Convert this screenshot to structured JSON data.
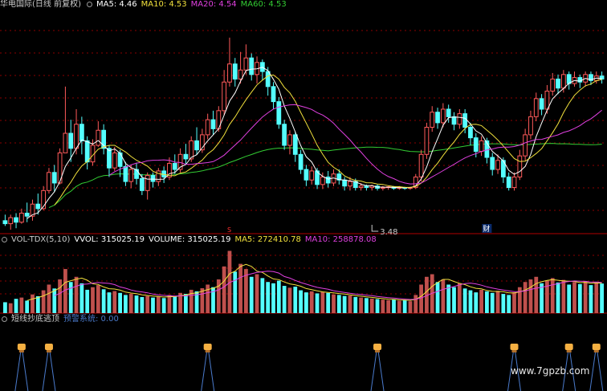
{
  "header": {
    "stock_title": "华电国际(日线 前复权)",
    "indicators": [
      {
        "label": "MA5: 4.46",
        "color": "#ffffff"
      },
      {
        "label": "MA10: 4.53",
        "color": "#f2e13c"
      },
      {
        "label": "MA20: 4.54",
        "color": "#e040e0"
      },
      {
        "label": "MA60: 4.53",
        "color": "#33cc33"
      }
    ]
  },
  "volume_header": {
    "name": "VOL-TDX(5,10)",
    "vvol": "VVOL: 315025.19",
    "volume": "VOLUME: 315025.19",
    "ma5": "MA5: 272410.78",
    "ma10": "MA10: 258878.08"
  },
  "indicator_header": {
    "name": "短线抄底逃顶",
    "system": "预警系统: 0.00"
  },
  "markers": {
    "low_price": "3.48",
    "cai_badge": "财",
    "s_badge": "S"
  },
  "watermark": "www.7gpzb.com",
  "colors": {
    "up": "#ff5a5a",
    "down": "#54ffff",
    "ma5": "#ffffff",
    "ma10": "#f2e13c",
    "ma20": "#e040e0",
    "ma60": "#33cc33",
    "volume_up": "#c0504d",
    "grid": "#8b0000",
    "signal": "#4a7acb",
    "badge": "#f5b042"
  },
  "chart_data": {
    "type": "candlestick",
    "y_min": 3.48,
    "y_max": 6.4,
    "ma_windows": [
      5,
      10,
      20,
      60
    ],
    "candles": [
      [
        3.62,
        3.58,
        3.7,
        3.55
      ],
      [
        3.58,
        3.66,
        3.7,
        3.5
      ],
      [
        3.66,
        3.6,
        3.72,
        3.52
      ],
      [
        3.6,
        3.72,
        3.78,
        3.58
      ],
      [
        3.72,
        3.68,
        3.86,
        3.6
      ],
      [
        3.68,
        3.84,
        3.9,
        3.62
      ],
      [
        3.84,
        3.78,
        3.98,
        3.7
      ],
      [
        3.78,
        4.02,
        4.08,
        3.76
      ],
      [
        4.02,
        4.26,
        4.32,
        3.98
      ],
      [
        4.26,
        4.12,
        4.36,
        4.0
      ],
      [
        4.12,
        4.52,
        4.58,
        4.1
      ],
      [
        4.52,
        4.78,
        5.4,
        4.6
      ],
      [
        4.78,
        4.58,
        4.96,
        4.4
      ],
      [
        4.58,
        4.9,
        5.1,
        4.5
      ],
      [
        4.9,
        4.68,
        5.0,
        4.5
      ],
      [
        4.68,
        4.4,
        4.74,
        4.3
      ],
      [
        4.4,
        4.62,
        4.7,
        4.35
      ],
      [
        4.62,
        4.82,
        4.94,
        4.6
      ],
      [
        4.82,
        4.58,
        4.9,
        4.5
      ],
      [
        4.58,
        4.32,
        4.62,
        4.2
      ],
      [
        4.32,
        4.52,
        4.6,
        4.28
      ],
      [
        4.52,
        4.34,
        4.56,
        4.2
      ],
      [
        4.34,
        4.14,
        4.4,
        4.08
      ],
      [
        4.14,
        4.3,
        4.36,
        4.05
      ],
      [
        4.3,
        4.18,
        4.38,
        4.1
      ],
      [
        4.18,
        4.02,
        4.24,
        3.96
      ],
      [
        4.02,
        4.22,
        4.26,
        3.9
      ],
      [
        4.22,
        4.14,
        4.26,
        4.06
      ],
      [
        4.14,
        4.28,
        4.32,
        4.08
      ],
      [
        4.28,
        4.2,
        4.34,
        4.12
      ],
      [
        4.2,
        4.38,
        4.46,
        4.16
      ],
      [
        4.38,
        4.3,
        4.5,
        4.24
      ],
      [
        4.3,
        4.5,
        4.58,
        4.26
      ],
      [
        4.5,
        4.44,
        4.64,
        4.36
      ],
      [
        4.44,
        4.68,
        4.74,
        4.4
      ],
      [
        4.68,
        4.56,
        4.86,
        4.5
      ],
      [
        4.56,
        4.76,
        4.84,
        4.52
      ],
      [
        4.76,
        4.96,
        5.04,
        4.7
      ],
      [
        4.96,
        4.84,
        5.08,
        4.76
      ],
      [
        4.84,
        5.08,
        5.14,
        4.8
      ],
      [
        5.08,
        5.46,
        5.62,
        5.02
      ],
      [
        5.46,
        5.7,
        6.05,
        5.4
      ],
      [
        5.7,
        5.5,
        5.78,
        5.4
      ],
      [
        5.5,
        5.62,
        5.86,
        5.44
      ],
      [
        5.62,
        5.78,
        5.96,
        5.56
      ],
      [
        5.78,
        5.56,
        5.84,
        5.48
      ],
      [
        5.56,
        5.72,
        5.8,
        5.44
      ],
      [
        5.72,
        5.6,
        5.76,
        5.48
      ],
      [
        5.6,
        5.4,
        5.66,
        5.28
      ],
      [
        5.4,
        5.2,
        5.46,
        5.1
      ],
      [
        5.2,
        4.9,
        5.26,
        4.84
      ],
      [
        4.9,
        4.62,
        4.96,
        4.56
      ],
      [
        4.62,
        4.76,
        4.82,
        4.5
      ],
      [
        4.76,
        4.5,
        4.8,
        4.4
      ],
      [
        4.5,
        4.3,
        4.56,
        4.24
      ],
      [
        4.3,
        4.16,
        4.36,
        4.08
      ],
      [
        4.16,
        4.28,
        4.34,
        4.1
      ],
      [
        4.28,
        4.1,
        4.32,
        4.04
      ],
      [
        4.1,
        4.2,
        4.26,
        4.04
      ],
      [
        4.2,
        4.12,
        4.28,
        4.06
      ],
      [
        4.12,
        4.24,
        4.3,
        4.08
      ],
      [
        4.24,
        4.16,
        4.3,
        4.1
      ],
      [
        4.16,
        4.08,
        4.2,
        4.02
      ],
      [
        4.08,
        4.14,
        4.2,
        4.02
      ],
      [
        4.14,
        4.06,
        4.18,
        4.02
      ],
      [
        4.06,
        4.08,
        4.12,
        4.02
      ],
      [
        4.08,
        4.06,
        4.1,
        4.02
      ],
      [
        4.06,
        4.08,
        4.1,
        4.02
      ],
      [
        4.08,
        4.05,
        4.1,
        4.02
      ],
      [
        4.05,
        4.06,
        4.08,
        4.02
      ],
      [
        4.06,
        4.07,
        4.08,
        4.03
      ],
      [
        4.07,
        4.05,
        4.08,
        4.03
      ],
      [
        4.05,
        4.06,
        4.08,
        4.03
      ],
      [
        4.06,
        4.05,
        4.07,
        4.03
      ],
      [
        4.05,
        4.06,
        4.07,
        4.03
      ],
      [
        4.06,
        4.2,
        4.24,
        4.04
      ],
      [
        4.2,
        4.5,
        4.56,
        4.14
      ],
      [
        4.5,
        4.86,
        4.92,
        4.44
      ],
      [
        4.86,
        5.06,
        5.14,
        4.8
      ],
      [
        5.06,
        4.92,
        5.12,
        4.84
      ],
      [
        4.92,
        5.1,
        5.18,
        4.86
      ],
      [
        5.1,
        5.0,
        5.16,
        4.92
      ],
      [
        5.0,
        4.9,
        5.06,
        4.82
      ],
      [
        4.9,
        5.04,
        5.1,
        4.84
      ],
      [
        5.04,
        4.86,
        5.1,
        4.78
      ],
      [
        4.86,
        4.72,
        4.92,
        4.62
      ],
      [
        4.72,
        4.54,
        4.78,
        4.46
      ],
      [
        4.54,
        4.68,
        4.74,
        4.48
      ],
      [
        4.68,
        4.46,
        4.72,
        4.38
      ],
      [
        4.46,
        4.3,
        4.52,
        4.22
      ],
      [
        4.3,
        4.42,
        4.5,
        4.24
      ],
      [
        4.42,
        4.2,
        4.46,
        4.12
      ],
      [
        4.2,
        4.06,
        4.26,
        4.02
      ],
      [
        4.06,
        4.2,
        4.26,
        4.02
      ],
      [
        4.2,
        4.48,
        4.56,
        4.16
      ],
      [
        4.48,
        4.76,
        4.84,
        4.42
      ],
      [
        4.76,
        5.0,
        5.08,
        4.7
      ],
      [
        5.0,
        5.24,
        5.32,
        4.94
      ],
      [
        5.24,
        5.1,
        5.3,
        5.02
      ],
      [
        5.1,
        5.34,
        5.42,
        5.04
      ],
      [
        5.34,
        5.5,
        5.58,
        5.28
      ],
      [
        5.5,
        5.38,
        5.56,
        5.3
      ],
      [
        5.38,
        5.56,
        5.62,
        5.32
      ],
      [
        5.56,
        5.44,
        5.6,
        5.36
      ],
      [
        5.44,
        5.52,
        5.6,
        5.4
      ],
      [
        5.52,
        5.46,
        5.56,
        5.38
      ],
      [
        5.46,
        5.56,
        5.6,
        5.4
      ],
      [
        5.56,
        5.48,
        5.6,
        5.42
      ],
      [
        5.48,
        5.54,
        5.6,
        5.44
      ],
      [
        5.54,
        5.5,
        5.6,
        5.44
      ]
    ],
    "volumes": [
      42,
      38,
      55,
      60,
      48,
      72,
      65,
      88,
      110,
      95,
      130,
      170,
      120,
      140,
      115,
      90,
      100,
      108,
      92,
      80,
      85,
      78,
      70,
      74,
      68,
      62,
      66,
      60,
      64,
      58,
      70,
      66,
      78,
      74,
      90,
      84,
      96,
      110,
      100,
      130,
      180,
      240,
      160,
      190,
      170,
      140,
      150,
      135,
      120,
      115,
      125,
      105,
      98,
      102,
      88,
      80,
      84,
      76,
      82,
      78,
      72,
      70,
      66,
      68,
      62,
      60,
      58,
      56,
      54,
      52,
      50,
      52,
      48,
      50,
      46,
      70,
      110,
      140,
      150,
      120,
      130,
      110,
      100,
      115,
      95,
      88,
      80,
      90,
      84,
      78,
      86,
      74,
      70,
      80,
      100,
      120,
      130,
      140,
      115,
      125,
      135,
      118,
      128,
      110,
      120,
      112,
      124,
      108,
      118,
      114
    ],
    "vol_max": 260,
    "signals": [
      3,
      8,
      37,
      68,
      93,
      103,
      108
    ],
    "vol_lines": {
      "ma5": "MA5: 272410.78",
      "ma10": "MA10: 258878.08"
    }
  }
}
